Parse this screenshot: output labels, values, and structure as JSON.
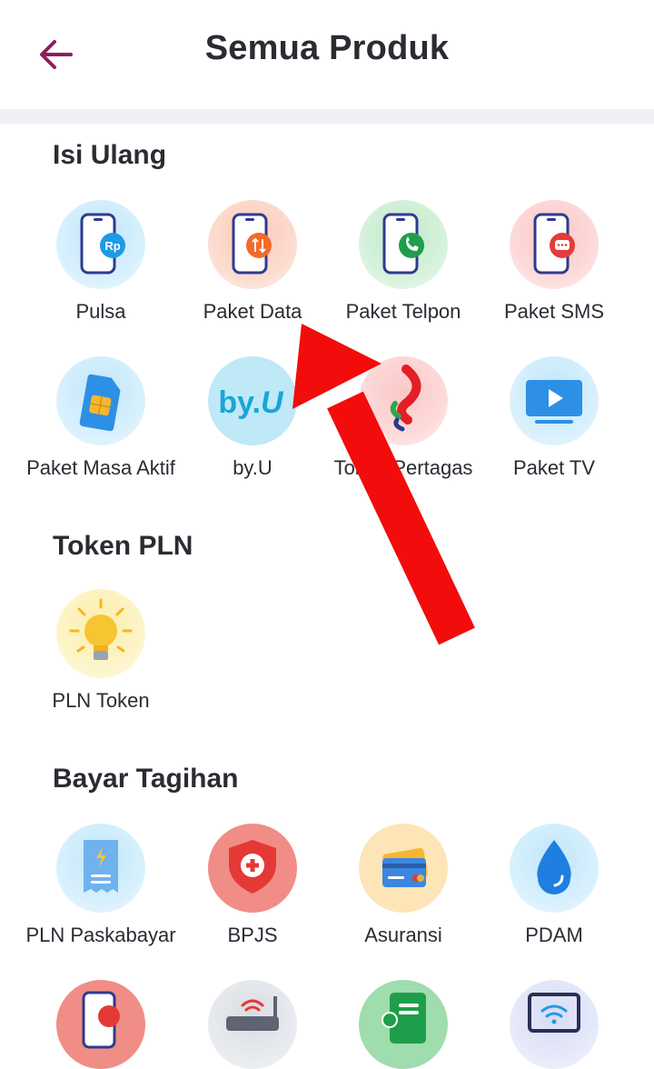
{
  "header": {
    "title": "Semua Produk"
  },
  "sections": [
    {
      "title": "Isi Ulang",
      "items": [
        {
          "label": "Pulsa",
          "icon": "phone-rp-icon"
        },
        {
          "label": "Paket Data",
          "icon": "phone-data-icon"
        },
        {
          "label": "Paket Telpon",
          "icon": "phone-call-icon"
        },
        {
          "label": "Paket SMS",
          "icon": "phone-sms-icon"
        },
        {
          "label": "Paket Masa Aktif",
          "icon": "sim-card-icon"
        },
        {
          "label": "by.U",
          "icon": "byu-logo-icon"
        },
        {
          "label": "Token Pertagas",
          "icon": "pertagas-logo-icon"
        },
        {
          "label": "Paket TV",
          "icon": "tv-play-icon"
        }
      ]
    },
    {
      "title": "Token PLN",
      "items": [
        {
          "label": "PLN Token",
          "icon": "light-bulb-icon"
        }
      ]
    },
    {
      "title": "Bayar Tagihan",
      "items": [
        {
          "label": "PLN Paskabayar",
          "icon": "electric-bill-icon"
        },
        {
          "label": "BPJS",
          "icon": "health-shield-icon"
        },
        {
          "label": "Asuransi",
          "icon": "insurance-card-icon"
        },
        {
          "label": "PDAM",
          "icon": "water-drop-icon"
        }
      ]
    }
  ],
  "colors": {
    "accent": "#8e1f5c",
    "annotation_arrow": "#f20c0c"
  }
}
